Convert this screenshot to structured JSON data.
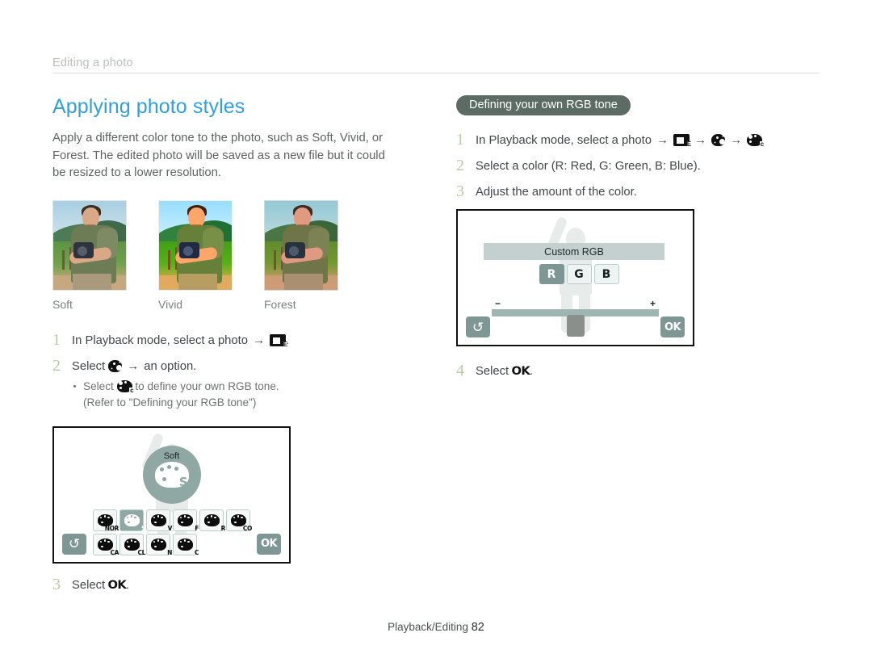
{
  "running_head": {
    "text": "Editing a photo"
  },
  "left": {
    "title": "Applying photo styles",
    "intro": "Apply a different color tone to the photo, such as Soft, Vivid, or Forest. The edited photo will be saved as a new file but it could be resized to a lower resolution.",
    "thumbnails": [
      {
        "label": "Soft"
      },
      {
        "label": "Vivid"
      },
      {
        "label": "Forest"
      }
    ],
    "steps": [
      {
        "num": "1",
        "text_before": "In Playback mode, select a photo",
        "arrow": "→",
        "icon": "edit-mode-icon",
        "text_after": "."
      },
      {
        "num": "2",
        "text_before": "Select",
        "arrow": "→",
        "icon": "palette-icon",
        "text_after": "an option.",
        "bullets": [
          {
            "text_before": "Select",
            "icon": "rgb-palette-icon",
            "text_after": "to define your own RGB tone."
          },
          {
            "text": "(Refer to \"Defining your RGB tone\")"
          }
        ]
      },
      {
        "num": "3",
        "text_before": "Select",
        "icon": "ok-icon",
        "icon_label": "OK",
        "text_after": "."
      }
    ],
    "screen": {
      "name": "photo-style-screen",
      "selected_label": "Soft",
      "selected_glyph": "S",
      "back_label": "back",
      "ok_label": "OK",
      "options_row1": [
        "NOR",
        "S",
        "V",
        "F",
        "R",
        "CO"
      ],
      "options_row2": [
        "CA",
        "CL",
        "N",
        "C"
      ],
      "selected_index": 1
    }
  },
  "right": {
    "badge": "Defining your own RGB tone",
    "steps": [
      {
        "num": "1",
        "text_before": "In Playback mode, select a photo",
        "arrow": "→",
        "icon1": "edit-mode-icon",
        "icon2": "palette-icon",
        "icon3": "rgb-palette-icon",
        "text_after": "."
      },
      {
        "num": "2",
        "text": "Select a color (R: Red, G: Green, B: Blue)."
      },
      {
        "num": "3",
        "text": "Adjust the amount of the color."
      },
      {
        "num": "4",
        "text_before": "Select",
        "icon": "ok-icon",
        "icon_label": "OK",
        "text_after": "."
      }
    ],
    "screen": {
      "name": "custom-rgb-screen",
      "title": "Custom RGB",
      "buttons": [
        "R",
        "G",
        "B"
      ],
      "active_button": "R",
      "minus": "−",
      "plus": "+",
      "back_label": "back",
      "ok_label": "OK"
    }
  },
  "footer": {
    "section": "Playback/Editing",
    "page": "82"
  },
  "colors": {
    "title_blue": "#2f9fe0",
    "badge_bg": "#5c6b63",
    "step_num": "#b8cba2",
    "screen_accent": "#7e9694"
  }
}
